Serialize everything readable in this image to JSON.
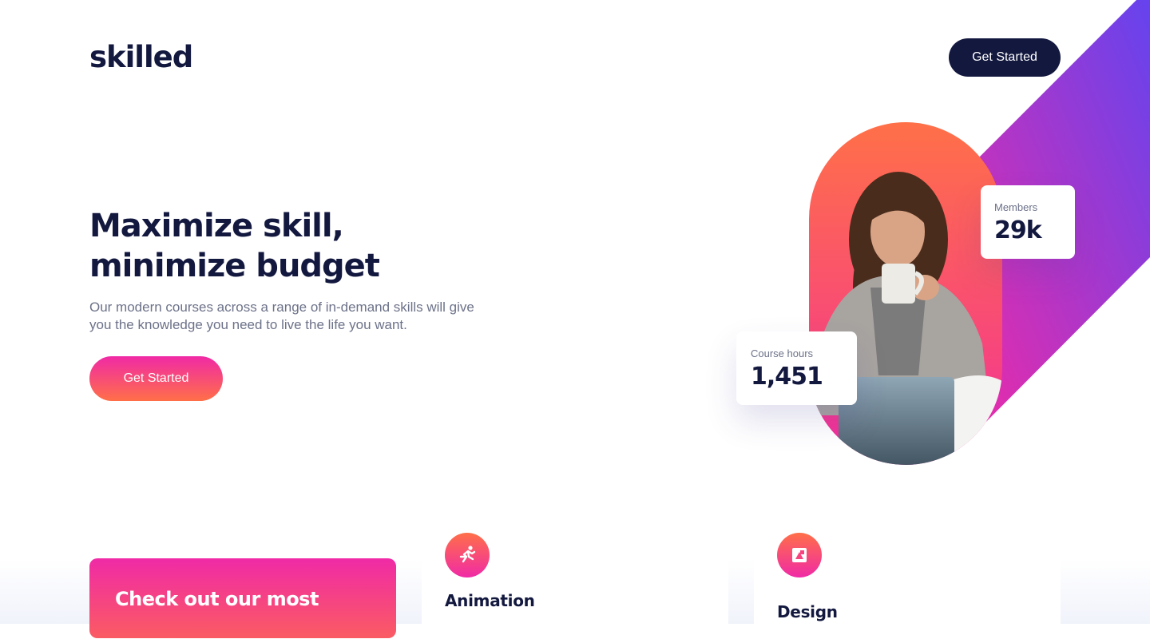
{
  "header": {
    "logo": "skilled",
    "cta_label": "Get Started"
  },
  "hero": {
    "title": "Maximize skill, minimize budget",
    "description": "Our modern courses across a range of in-demand skills will give you the knowledge you need to live the life you want.",
    "cta_label": "Get Started"
  },
  "stats": {
    "members": {
      "label": "Members",
      "value": "29k"
    },
    "course_hours": {
      "label": "Course hours",
      "value": "1,451"
    }
  },
  "promo": {
    "text": "Check out our most"
  },
  "courses": [
    {
      "title": "Animation",
      "icon": "running-person-icon"
    },
    {
      "title": "Design",
      "icon": "design-icon"
    }
  ],
  "colors": {
    "navy": "#13183f",
    "pink": "#f02aa6",
    "orange": "#ff6f48",
    "purple": "#6543ee",
    "grey_text": "#6c7289"
  }
}
